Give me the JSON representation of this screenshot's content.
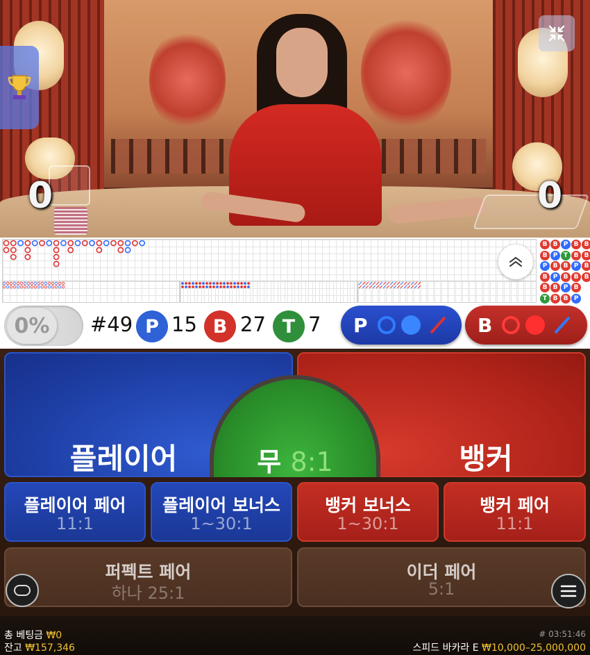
{
  "video": {
    "score_player": "0",
    "score_banker": "0"
  },
  "icons": {
    "trophy": "trophy-icon",
    "collapse": "collapse-arrows-icon",
    "expand": "chevron-up-icon",
    "chip": "chip-stack-icon",
    "menu": "hamburger-menu-icon"
  },
  "stats": {
    "percent": "0%",
    "shoe_number": "#49",
    "player_letter": "P",
    "player_count": "15",
    "banker_letter": "B",
    "banker_count": "27",
    "tie_letter": "T",
    "tie_count": "7",
    "player_predict_label": "P",
    "banker_predict_label": "B"
  },
  "colors": {
    "player": "#2f62d6",
    "banker": "#d2322a",
    "tie": "#2f8f3a"
  },
  "bets": {
    "player": "플레이어",
    "tie_label": "무",
    "tie_odds": "8:1",
    "banker": "뱅커",
    "player_pair": "플레이어 페어",
    "player_pair_odds": "11:1",
    "player_bonus": "플레이어 보너스",
    "player_bonus_odds": "1~30:1",
    "banker_bonus": "뱅커 보너스",
    "banker_bonus_odds": "1~30:1",
    "banker_pair": "뱅커 페어",
    "banker_pair_odds": "11:1",
    "perfect_pair": "퍼펙트 페어",
    "perfect_pair_odds": "하나 25:1",
    "either_pair": "이더 페어",
    "either_pair_odds": "5:1"
  },
  "footer": {
    "total_bet_label": "총 베팅금",
    "total_bet_value": "₩0",
    "balance_label": "잔고",
    "balance_value": "₩157,346",
    "round_id": "# 03:51:46",
    "table_name": "스피드 바카라 E",
    "limits": "₩10,000–25,000,000"
  }
}
